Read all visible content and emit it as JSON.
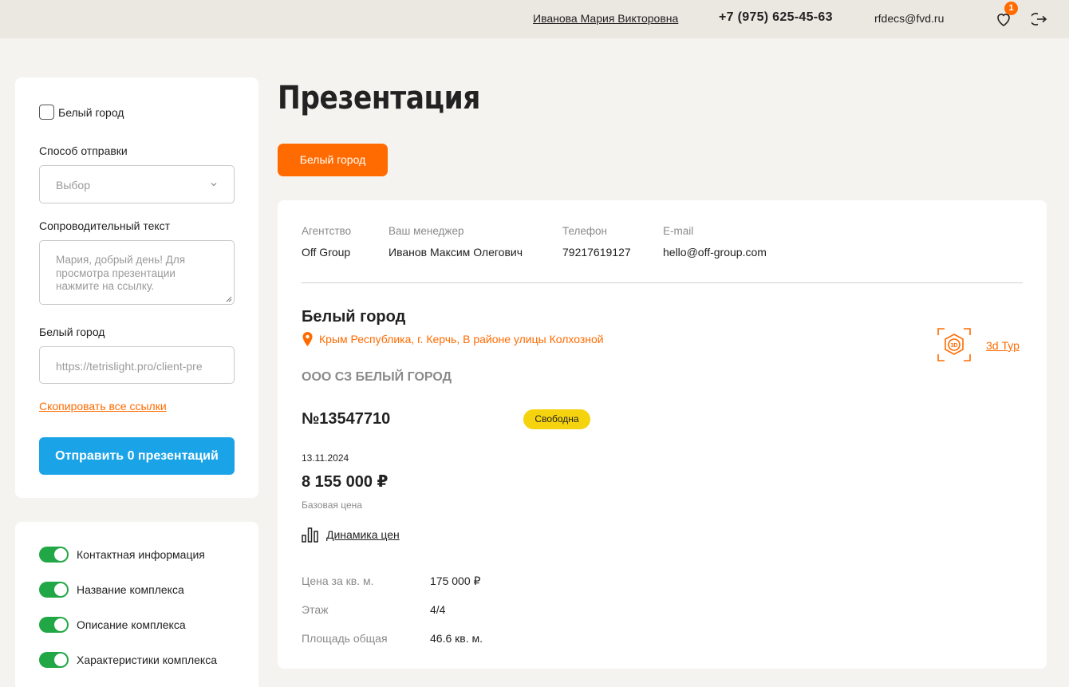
{
  "header": {
    "user_name": "Иванова Мария Викторовна",
    "phone": "+7 (975) 625-45-63",
    "email": "rfdecs@fvd.ru",
    "favorites_count": "1",
    "favorites_icon": "heart-icon",
    "logout_icon": "logout-icon"
  },
  "sidebar": {
    "complex_checkbox_label": "Белый город",
    "send_method_label": "Способ отправки",
    "send_method_value": "Выбор",
    "cover_text_label": "Сопроводительный текст",
    "cover_text_placeholder": "Мария, добрый день!  Для просмотра презентации нажмите на ссылку.",
    "link_label": "Белый город",
    "link_value": "https://tetrislight.pro/client-pre",
    "copy_links": "Скопировать все ссылки",
    "send_button": "Отправить 0 презентаций",
    "toggles": [
      {
        "label": "Контактная информация",
        "on": true
      },
      {
        "label": "Название комплекса",
        "on": true
      },
      {
        "label": "Описание комплекса",
        "on": true
      },
      {
        "label": "Характеристики комплекса",
        "on": true
      }
    ]
  },
  "main": {
    "page_title": "Презентация",
    "complex_tab": "Белый город",
    "contacts": {
      "agency_label": "Агентство",
      "agency_value": "Off Group",
      "manager_label": "Ваш менеджер",
      "manager_value": "Иванов Максим Олегович",
      "phone_label": "Телефон",
      "phone_value": "79217619127",
      "email_label": "E-mail",
      "email_value": "hello@off-group.com"
    },
    "complex_name": "Белый город",
    "address": "Крым Республика, г. Керчь, В районе улицы Колхозной",
    "tour_link": "3d Тур",
    "tour_icon_text": "3D",
    "developer": "ООО СЗ БЕЛЫЙ ГОРОД",
    "lot_number": "№13547710",
    "status": "Свободна",
    "date": "13.11.2024",
    "price": "8 155 000 ₽",
    "price_label": "Базовая цена",
    "dynamics_link": "Динамика цен",
    "specs": [
      {
        "label": "Цена за кв. м.",
        "value": "175 000 ₽"
      },
      {
        "label": "Этаж",
        "value": "4/4"
      },
      {
        "label": "Площадь общая",
        "value": "46.6 кв. м."
      }
    ]
  },
  "colors": {
    "accent": "#ff6b00",
    "primary_button": "#1ba3e8",
    "toggle_on": "#21a745",
    "status_badge": "#f5d30f",
    "page_bg": "#f5f3ef",
    "header_bg": "#ebe7e1"
  }
}
